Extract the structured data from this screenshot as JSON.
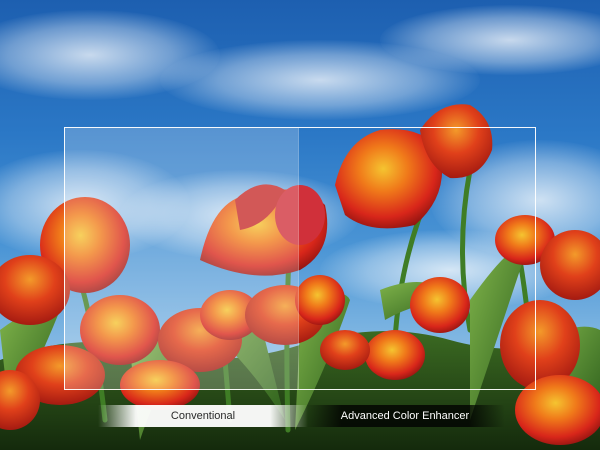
{
  "labels": {
    "left": "Conventional",
    "right": "Advanced Color Enhancer"
  },
  "colors": {
    "sky_top": "#1d5fb0",
    "sky_bottom": "#a9cdec",
    "tulip_red": "#d8261a",
    "tulip_orange": "#f07a1a",
    "tulip_yellow_edge": "#f5c430",
    "stem_green": "#3f7d25"
  }
}
